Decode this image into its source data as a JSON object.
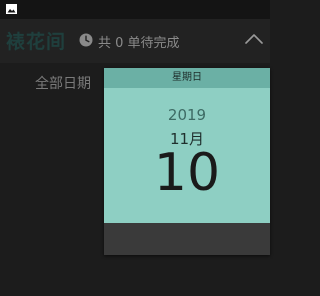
{
  "app": {
    "title": "裱花间",
    "pending_status": "共 0 单待完成"
  },
  "filter": {
    "tab_label": "全部日期"
  },
  "date_picker": {
    "weekday": "星期日",
    "year": "2019",
    "month": "11月",
    "day": "10"
  },
  "icons": {
    "status": "image-icon",
    "clock": "clock-icon",
    "collapse": "chevron-up-icon"
  },
  "colors": {
    "header_teal": "#6bb0a5",
    "body_teal": "#8ecfc3",
    "title_green": "#1f3f3d"
  }
}
